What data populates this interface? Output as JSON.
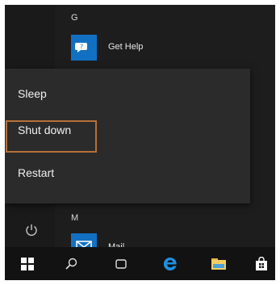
{
  "start_menu": {
    "group_g": "G",
    "get_help_label": "Get Help",
    "group_m": "M",
    "mail_label": "Mail"
  },
  "power_menu": {
    "items": [
      {
        "label": "Sleep"
      },
      {
        "label": "Shut down"
      },
      {
        "label": "Restart"
      }
    ],
    "focused": "Shut down"
  },
  "taskbar": {
    "icons": [
      "windows-start-icon",
      "search-icon",
      "task-view-icon",
      "edge-icon",
      "file-explorer-icon",
      "store-icon"
    ]
  },
  "colors": {
    "accent": "#1270c2",
    "edge": "#1e90e0",
    "focus_outline": "#b5703a",
    "menu_bg": "#2b2b2b",
    "taskbar_bg": "#121212"
  }
}
